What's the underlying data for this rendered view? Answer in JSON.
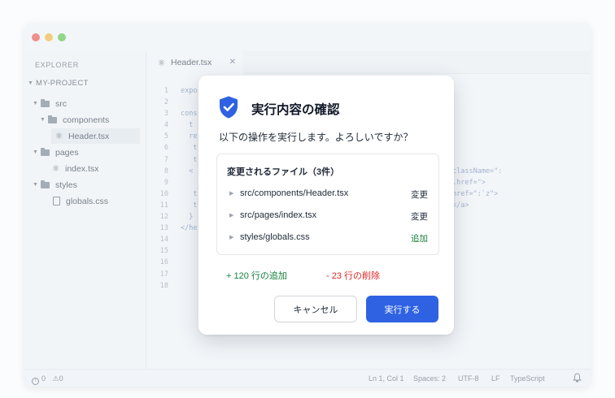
{
  "colors": {
    "traffic_red": "#ee5a52",
    "traffic_yellow": "#f4b73e",
    "traffic_green": "#5ec54a",
    "accent_blue": "#2f62e3",
    "added_green": "#15803d",
    "deleted_red": "#dc2626"
  },
  "sidebar": {
    "title": "EXPLORER",
    "project": "MY-PROJECT",
    "tree": {
      "src": "src",
      "components": "components",
      "header_tsx": "Header.tsx",
      "pages": "pages",
      "index_tsx": "index.tsx",
      "styles": "styles",
      "globals_css": "globals.css"
    }
  },
  "editor": {
    "tab_label": "Header.tsx",
    "line_numbers": [
      "1",
      "2",
      "3",
      "4",
      "5",
      "6",
      "7",
      "8",
      "9",
      "10",
      "11",
      "12",
      "13",
      "14",
      "15",
      "16",
      "17",
      "18"
    ],
    "code_left": "expo\n\ncons\n  t\n  re\n   t\n   t\n  <\n\n   t\n   t\n  }\n</he",
    "code_right": "className=\":\n.href=\">\nhref=\":`z\">\n</a>"
  },
  "statusbar": {
    "errors": "0",
    "warnings": "0",
    "position": "Ln 1, Col 1",
    "spaces": "Spaces: 2",
    "encoding": "UTF-8",
    "eol": "LF",
    "language": "TypeScript"
  },
  "dialog": {
    "icon": "shield-check-icon",
    "title": "実行内容の確認",
    "subtitle": "以下の操作を実行します。よろしいですか？",
    "files_heading": "変更されるファイル（3件）",
    "files": [
      {
        "path": "src/components/Header.tsx",
        "change": "変更"
      },
      {
        "path": "src/pages/index.tsx",
        "change": "変更"
      },
      {
        "path": "styles/globals.css",
        "change": "追加"
      }
    ],
    "additions": "+ 120 行の追加",
    "deletions": "- 23 行の削除",
    "cancel_label": "キャンセル",
    "confirm_label": "実行する"
  }
}
